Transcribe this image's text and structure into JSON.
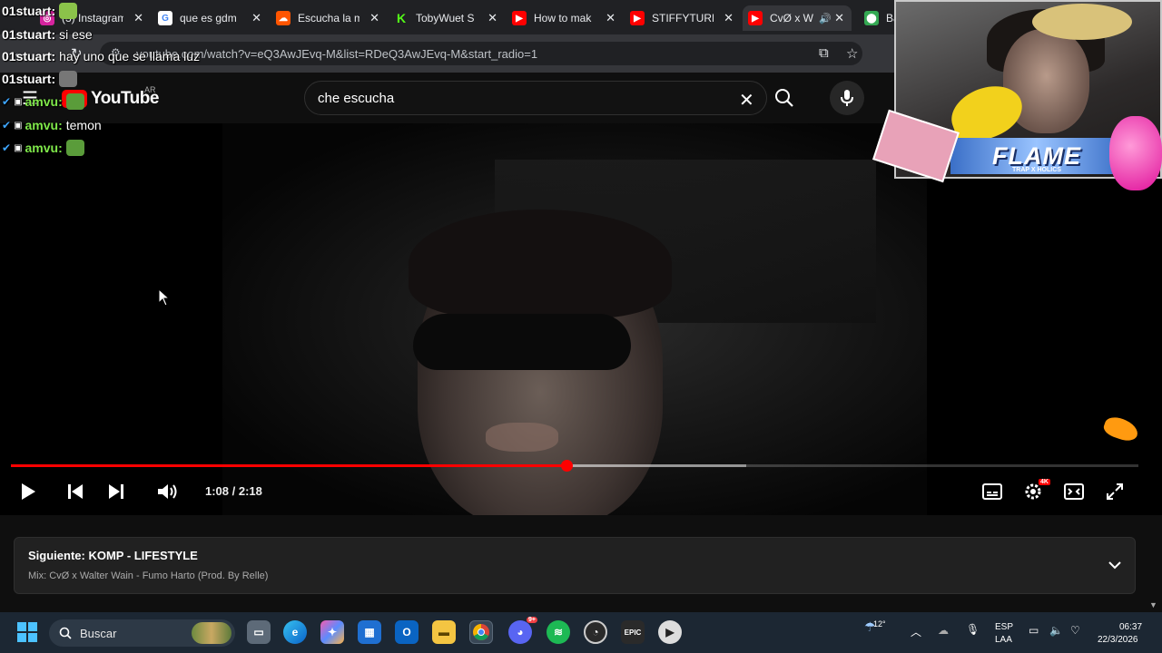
{
  "browser": {
    "tabs": [
      {
        "label": "(3) Instagram",
        "favicon": "instagram-icon",
        "color": "#d6249f"
      },
      {
        "label": "que es gdm",
        "favicon": "google-icon",
        "color": "#4285f4"
      },
      {
        "label": "Escucha la m",
        "favicon": "soundcloud-icon",
        "color": "#ff5500"
      },
      {
        "label": "TobyWuet S",
        "favicon": "kick-icon",
        "color": "#53fc18"
      },
      {
        "label": "How to mak",
        "favicon": "youtube-icon",
        "color": "#ff0000"
      },
      {
        "label": "STIFFYTURR",
        "favicon": "youtube-icon",
        "color": "#ff0000"
      },
      {
        "label": "CvØ x W",
        "favicon": "youtube-icon",
        "color": "#ff0000"
      },
      {
        "label": "Ba",
        "favicon": "maps-icon",
        "color": "#34a853"
      }
    ],
    "url": "youtube.com/watch?v=eQ3AwJEvq-M&list=RDeQ3AwJEvq-M&start_radio=1"
  },
  "youtube": {
    "logo_text": "YouTube",
    "country": "AR",
    "search_value": "che escucha"
  },
  "player": {
    "current_time": "1:08",
    "duration": "2:18",
    "time_display": "1:08 / 2:18",
    "progress_fraction": 0.493,
    "buffered_fraction": 0.652,
    "settings_badge": "4K"
  },
  "up_next": {
    "label": "Siguiente:",
    "title": "KOMP - LIFESTYLE",
    "mix": "Mix: CvØ x Walter Wain - Fumo Harto (Prod. By Relle)"
  },
  "chat": [
    {
      "user": "01stuart:",
      "text": "",
      "emote": "cat-emote",
      "green": false
    },
    {
      "user": "01stuart:",
      "text": "si ese",
      "emote": "",
      "green": false
    },
    {
      "user": "01stuart:",
      "text": "hay uno que se llama luz",
      "emote": "",
      "green": false
    },
    {
      "user": "01stuart:",
      "text": "",
      "emote": "cat-emote",
      "green": false
    },
    {
      "user": "amvu:",
      "text": "",
      "emote": "pepe-emote",
      "green": true
    },
    {
      "user": "amvu:",
      "text": "temon",
      "emote": "",
      "green": true
    },
    {
      "user": "amvu:",
      "text": "",
      "emote": "pepe-emote",
      "green": true
    }
  ],
  "webcam": {
    "banner_text": "FLAME",
    "banner_sub": "TRAP X HOLICS"
  },
  "taskbar": {
    "search_placeholder": "Buscar",
    "weather_temp": "12°",
    "lang_top": "ESP",
    "lang_bottom": "LAA",
    "clock_time": "06:37",
    "clock_date": "22/3/2026",
    "discord_badge": "9+"
  }
}
